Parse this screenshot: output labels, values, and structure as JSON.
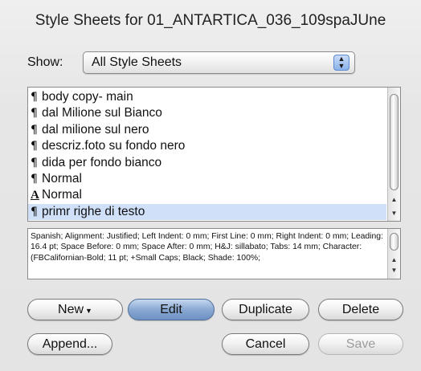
{
  "window": {
    "title": "Style Sheets for 01_ANTARTICA_036_109spaJUne"
  },
  "show": {
    "label": "Show:",
    "value": "All Style Sheets"
  },
  "styles": [
    {
      "glyph": "¶",
      "kind": "paragraph",
      "name": "body copy- main",
      "selected": false
    },
    {
      "glyph": "¶",
      "kind": "paragraph",
      "name": "dal Milione sul Bianco",
      "selected": false
    },
    {
      "glyph": "¶",
      "kind": "paragraph",
      "name": "dal milione sul nero",
      "selected": false
    },
    {
      "glyph": "¶",
      "kind": "paragraph",
      "name": "descriz.foto su fondo nero",
      "selected": false
    },
    {
      "glyph": "¶",
      "kind": "paragraph",
      "name": "dida per fondo bianco",
      "selected": false
    },
    {
      "glyph": "¶",
      "kind": "paragraph",
      "name": "Normal",
      "selected": false
    },
    {
      "glyph": "A",
      "kind": "character",
      "name": "Normal",
      "selected": false
    },
    {
      "glyph": "¶",
      "kind": "paragraph",
      "name": "primr righe di testo",
      "selected": true
    }
  ],
  "description": "Spanish;  Alignment: Justified;  Left Indent: 0 mm;  First Line: 0 mm;  Right Indent: 0 mm;  Leading: 16.4 pt;  Space Before: 0 mm;  Space After: 0 mm;  H&J: sillabato;  Tabs: 14 mm;  Character: (FBCalifornian-Bold;  11 pt;  +Small Caps;  Black;  Shade: 100%;",
  "buttons": {
    "new": "New",
    "edit": "Edit",
    "duplicate": "Duplicate",
    "delete": "Delete",
    "append": "Append...",
    "cancel": "Cancel",
    "save": "Save"
  },
  "icons": {
    "select_stepper": "up-down-arrows-icon",
    "new_menu": "triangle-down-icon",
    "scroll_up": "arrow-up-icon",
    "scroll_down": "arrow-down-icon"
  },
  "colors": {
    "selection": "#cfe0f8",
    "default_button": "#8aa9d2"
  }
}
